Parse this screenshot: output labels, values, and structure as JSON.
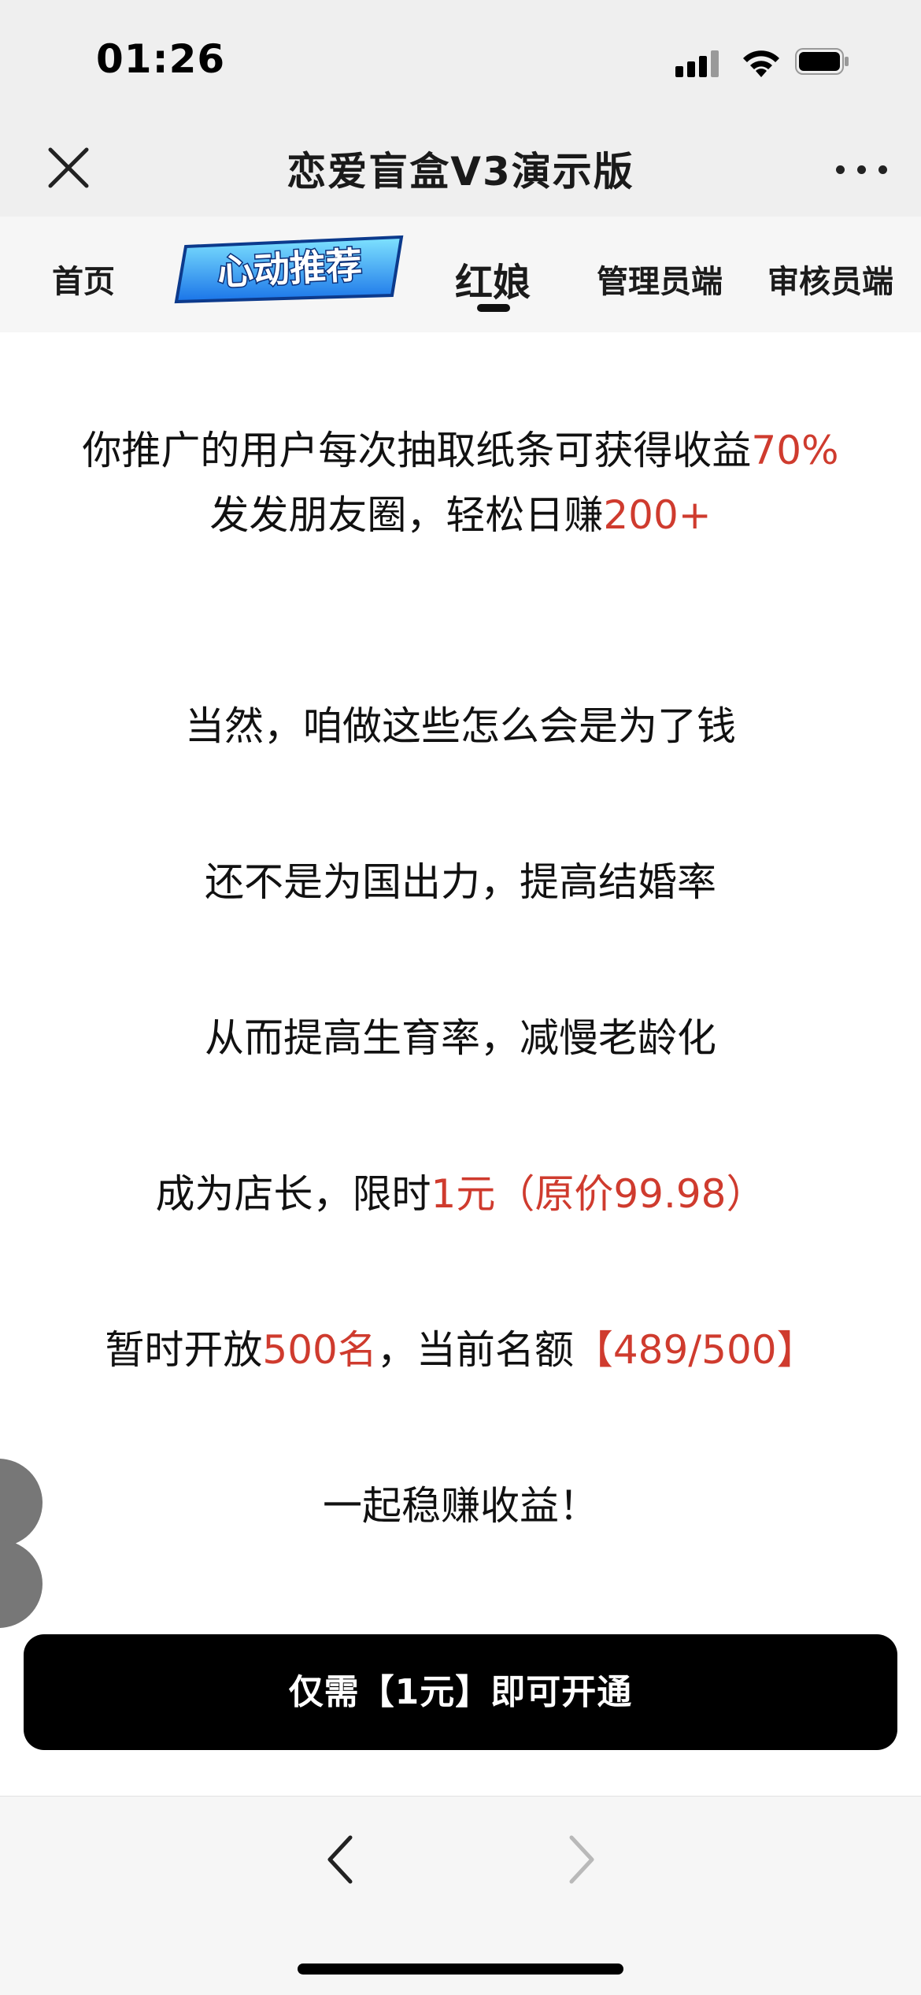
{
  "status": {
    "time": "01:26"
  },
  "nav": {
    "title": "恋爱盲盒V3演示版"
  },
  "tabs": {
    "home": "首页",
    "matchmaker": "红娘",
    "admin": "管理员端",
    "reviewer": "审核员端",
    "promo_badge": "心动推荐"
  },
  "content": {
    "line1_pre": "你推广的用户每次抽取纸条可获得收益",
    "line1_red": "70%",
    "line2_pre": "发发朋友圈，轻松日赚",
    "line2_red": "200+",
    "line3": "当然，咱做这些怎么会是为了钱",
    "line4": "还不是为国出力，提高结婚率",
    "line5": "从而提高生育率，减慢老龄化",
    "line6_pre": "成为店长，限时",
    "line6_red": "1元（原价99.98）",
    "line7_pre": "暂时开放",
    "line7_red1": "500名",
    "line7_mid": "，当前名额",
    "line7_red2": "【489/500】",
    "line8": "一起稳赚收益！"
  },
  "cta": {
    "label": "仅需【1元】即可开通"
  },
  "colors": {
    "accent_red": "#cf3b2e",
    "button_bg": "#000000"
  }
}
